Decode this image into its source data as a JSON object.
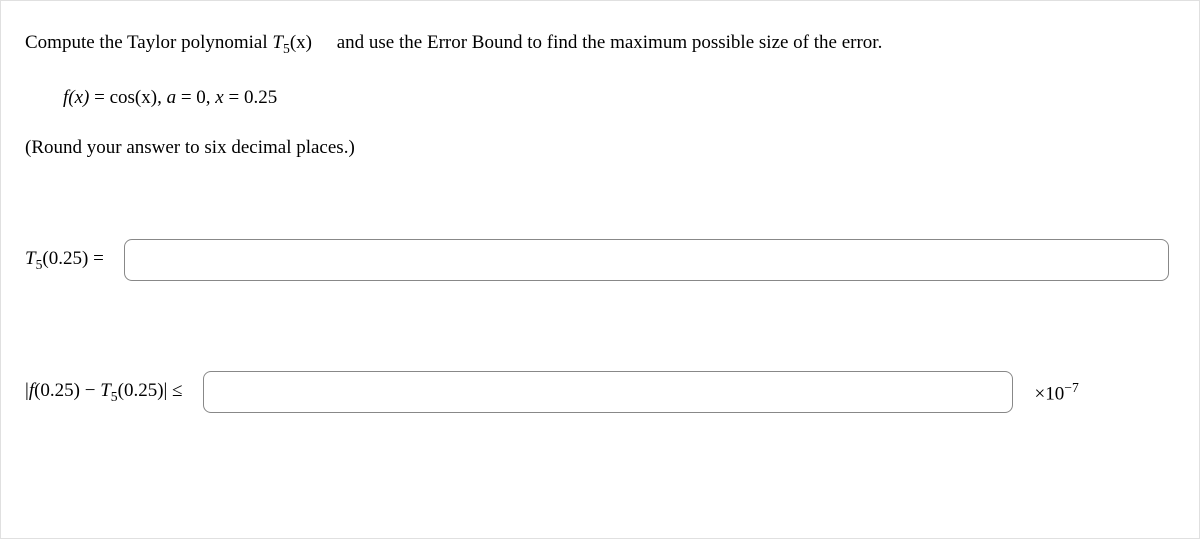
{
  "question": {
    "prompt_prefix": "Compute the Taylor polynomial ",
    "poly_symbol_base": "T",
    "poly_symbol_sub": "5",
    "poly_symbol_arg": "(x)",
    "prompt_suffix": " and use the Error Bound to find the maximum possible size of the error."
  },
  "formula": {
    "lhs": "f(x)",
    "eq1": " = ",
    "rhs1_fn": "cos",
    "rhs1_arg": "(x), ",
    "a_var": "a",
    "eq2": " = 0, ",
    "x_var": "x",
    "eq3": " = 0.25"
  },
  "round_note": "(Round your answer to six decimal places.)",
  "row1": {
    "label_base": "T",
    "label_sub": "5",
    "label_arg": "(0.25) = ",
    "value": ""
  },
  "row2": {
    "label_open": "|",
    "label_f": "f",
    "label_arg1": "(0.25) − ",
    "label_T": "T",
    "label_Tsub": "5",
    "label_arg2": "(0.25)| ≤ ",
    "value": "",
    "suffix_times": "×10",
    "suffix_exp": "−7"
  }
}
